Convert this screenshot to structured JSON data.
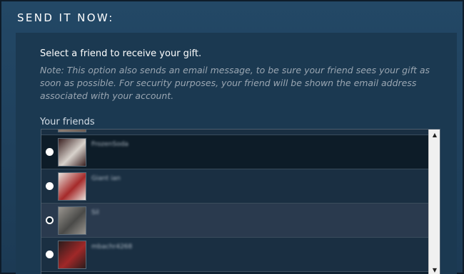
{
  "section": {
    "title": "SEND IT NOW:"
  },
  "instructions": {
    "prompt": "Select a friend to receive your gift.",
    "note": "Note: This option also sends an email message, to be sure your friend sees your gift as soon as possible. For security purposes, your friend will be shown the email address associated with your account."
  },
  "friends": {
    "label": "Your friends",
    "items": [
      {
        "name": "",
        "selected": false,
        "avatar_colors": [
          "#6a5a52",
          "#8a7b70"
        ]
      },
      {
        "name": "FrozenSoda",
        "selected": false,
        "avatar_colors": [
          "#3a2020",
          "#d8d2cc"
        ]
      },
      {
        "name": "Giant ian",
        "selected": false,
        "avatar_colors": [
          "#e8e2dc",
          "#a62a2a"
        ]
      },
      {
        "name": "Sil",
        "selected": true,
        "avatar_colors": [
          "#9a9690",
          "#4a4a48"
        ]
      },
      {
        "name": "mbachr4268",
        "selected": false,
        "avatar_colors": [
          "#2a1c1c",
          "#a02828"
        ]
      }
    ]
  },
  "colors": {
    "background": "#1f3b55",
    "panel": "#1b3951",
    "list_background": "#0f2231",
    "row_highlight": "#2a3a4e",
    "row_normal": "#1a2f42",
    "note_text": "#9aa6b2"
  },
  "icons": {
    "scroll_up": "▲",
    "scroll_down": "▼"
  }
}
